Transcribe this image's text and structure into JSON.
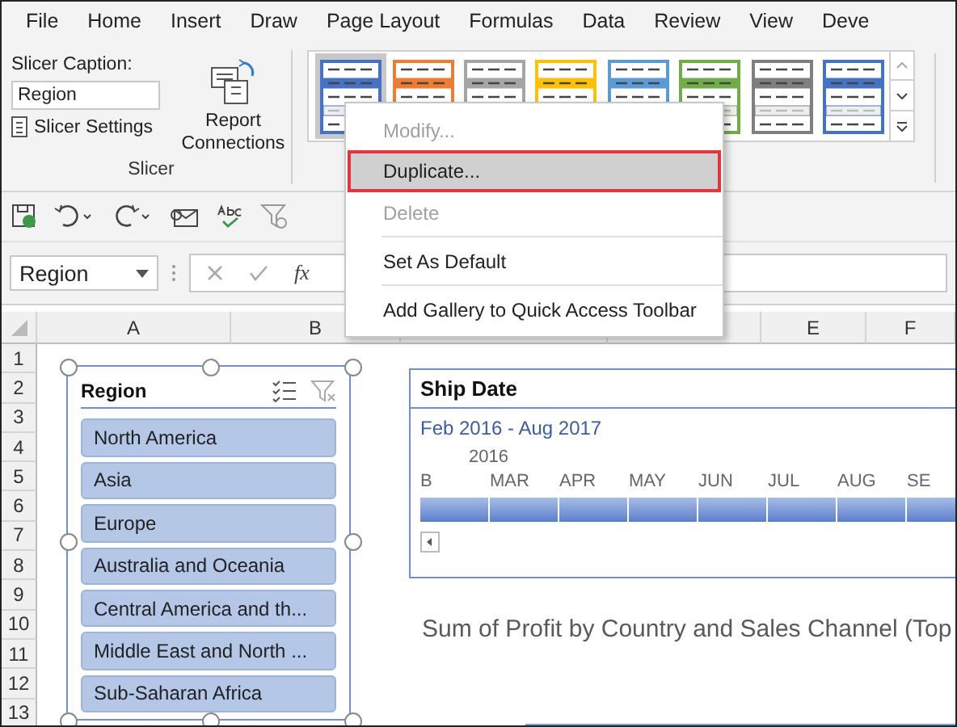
{
  "menu_tabs": [
    {
      "label": "File",
      "selected": false
    },
    {
      "label": "Home",
      "selected": false
    },
    {
      "label": "Insert",
      "selected": false
    },
    {
      "label": "Draw",
      "selected": false
    },
    {
      "label": "Page Layout",
      "selected": false
    },
    {
      "label": "Formulas",
      "selected": false
    },
    {
      "label": "Data",
      "selected": false
    },
    {
      "label": "Review",
      "selected": false
    },
    {
      "label": "View",
      "selected": false
    },
    {
      "label": "Deve",
      "selected": false
    }
  ],
  "ribbon": {
    "caption_label": "Slicer Caption:",
    "caption_value": "Region",
    "settings_button": "Slicer Settings",
    "connections_button": "Report Connections",
    "group_label": "Slicer",
    "styles": [
      {
        "color": "#4472c4",
        "selected": true
      },
      {
        "color": "#ed7d31",
        "selected": false
      },
      {
        "color": "#a5a5a5",
        "selected": false
      },
      {
        "color": "#ffc000",
        "selected": false
      },
      {
        "color": "#5b9bd5",
        "selected": false
      },
      {
        "color": "#70ad47",
        "selected": false
      },
      {
        "color": "#7f7f7f",
        "selected": false
      },
      {
        "color": "#4472c4",
        "selected": false
      }
    ]
  },
  "formula_bar": {
    "name_box": "Region",
    "function_label": "fx"
  },
  "columns": [
    "A",
    "B",
    "E",
    "F"
  ],
  "rows": [
    "1",
    "2",
    "3",
    "4",
    "5",
    "6",
    "7",
    "8",
    "9",
    "10",
    "11",
    "12",
    "13"
  ],
  "slicer": {
    "title": "Region",
    "items": [
      {
        "label": "North America",
        "selected": true
      },
      {
        "label": "Asia",
        "selected": true
      },
      {
        "label": "Europe",
        "selected": true
      },
      {
        "label": "Australia and Oceania",
        "selected": true
      },
      {
        "label": "Central America and th...",
        "selected": true
      },
      {
        "label": "Middle East and North ...",
        "selected": true
      },
      {
        "label": "Sub-Saharan Africa",
        "selected": true
      }
    ]
  },
  "timeline": {
    "title": "Ship Date",
    "range": "Feb 2016 - Aug 2017",
    "year": "2016",
    "months": [
      "B",
      "MAR",
      "APR",
      "MAY",
      "JUN",
      "JUL",
      "AUG",
      "SE"
    ]
  },
  "chart": {
    "title": "Sum of Profit by Country and Sales Channel (Top"
  },
  "context_menu": {
    "items": [
      {
        "label": "Modify...",
        "disabled": true,
        "selected": false,
        "separator_before": false
      },
      {
        "label": "Duplicate...",
        "disabled": false,
        "selected": true,
        "separator_before": false
      },
      {
        "label": "Delete",
        "disabled": true,
        "selected": false,
        "separator_before": false
      },
      {
        "label": "Set As Default",
        "disabled": false,
        "selected": false,
        "separator_before": true
      },
      {
        "label": "Add Gallery to Quick Access Toolbar",
        "disabled": false,
        "selected": false,
        "separator_before": true
      }
    ]
  }
}
